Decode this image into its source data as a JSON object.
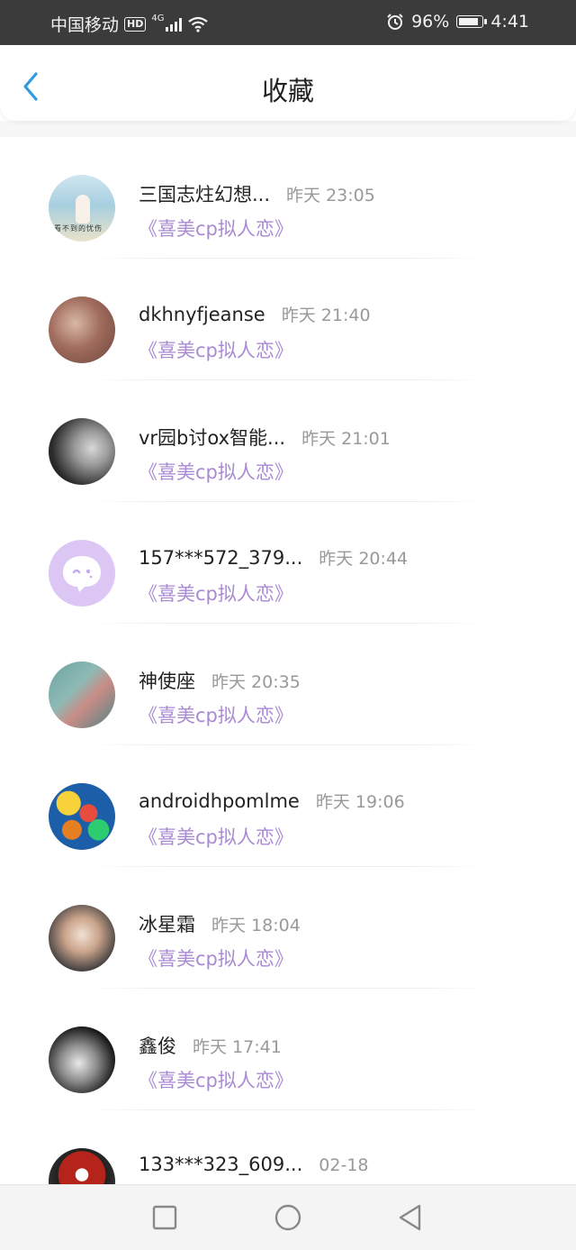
{
  "status_bar": {
    "carrier": "中国移动",
    "hd": "HD",
    "network": "4G",
    "battery": "96%",
    "battery_level": 0.96,
    "time": "4:41",
    "icons": [
      "hd-icon",
      "signal-icon",
      "wifi-icon",
      "alarm-icon",
      "battery-icon"
    ]
  },
  "header": {
    "title": "收藏",
    "back_icon": "chevron-left-icon",
    "accent_color": "#2f9be0"
  },
  "colors": {
    "book_text": "#a98ad3",
    "time_text": "#999999"
  },
  "items": [
    {
      "name": "三国志炷幻想...",
      "time": "昨天 23:05",
      "book": "《喜美cp拟人恋》",
      "avatar_caption": "看不到的忧伤"
    },
    {
      "name": "dkhnyfjeanse",
      "time": "昨天 21:40",
      "book": "《喜美cp拟人恋》"
    },
    {
      "name": "vr园b讨ox智能...",
      "time": "昨天 21:01",
      "book": "《喜美cp拟人恋》"
    },
    {
      "name": "157***572_379...",
      "time": "昨天 20:44",
      "book": "《喜美cp拟人恋》"
    },
    {
      "name": "神使座",
      "time": "昨天 20:35",
      "book": "《喜美cp拟人恋》"
    },
    {
      "name": "androidhpomlme",
      "time": "昨天 19:06",
      "book": "《喜美cp拟人恋》"
    },
    {
      "name": "冰星霜",
      "time": "昨天 18:04",
      "book": "《喜美cp拟人恋》"
    },
    {
      "name": "鑫俊",
      "time": "昨天 17:41",
      "book": "《喜美cp拟人恋》"
    },
    {
      "name": "133***323_609...",
      "time": "02-18",
      "book": ""
    }
  ],
  "nav_bar": {
    "buttons": [
      "recent-apps-square-icon",
      "home-circle-icon",
      "back-triangle-icon"
    ]
  }
}
